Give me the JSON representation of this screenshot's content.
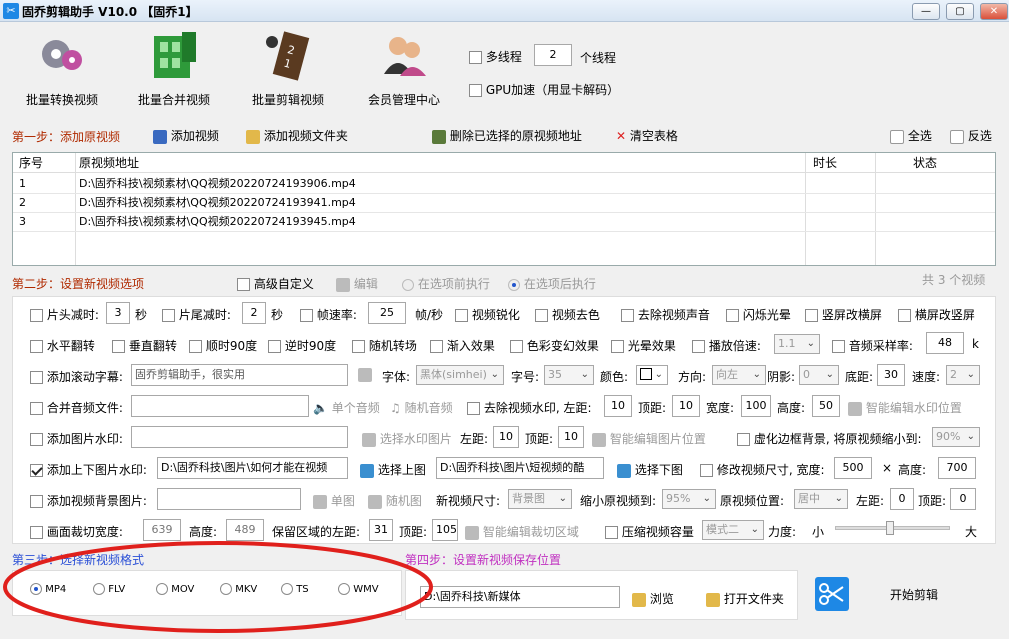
{
  "window": {
    "title": "固乔剪辑助手 V10.0  【固乔1】",
    "icon": "scissors-app-icon",
    "controls": [
      "—",
      "▢",
      "✕"
    ]
  },
  "toolbar": {
    "batch_convert": "批量转换视频",
    "batch_merge": "批量合并视频",
    "batch_edit": "批量剪辑视频",
    "member": "会员管理中心",
    "multithread_label": "多线程",
    "thread_count": "2",
    "thread_unit": "个线程",
    "gpu_label": "GPU加速（用显卡解码）"
  },
  "step1": {
    "title": "第一步：添加原视频",
    "add_video": "添加视频",
    "add_folder": "添加视频文件夹",
    "delete_selected": "删除已选择的原视频地址",
    "clear_table": "清空表格",
    "select_all": "全选",
    "invert_select": "反选"
  },
  "table": {
    "headers": [
      "序号",
      "原视频地址",
      "时长",
      "状态"
    ],
    "rows": [
      {
        "idx": "1",
        "path": "D:\\固乔科技\\视频素材\\QQ视频20220724193906.mp4",
        "duration": "",
        "status": ""
      },
      {
        "idx": "2",
        "path": "D:\\固乔科技\\视频素材\\QQ视频20220724193941.mp4",
        "duration": "",
        "status": ""
      },
      {
        "idx": "3",
        "path": "D:\\固乔科技\\视频素材\\QQ视频20220724193945.mp4",
        "duration": "",
        "status": ""
      }
    ]
  },
  "step2": {
    "title": "第二步：设置新视频选项",
    "advanced": "高级自定义",
    "edit": "编辑",
    "before": "在选项前执行",
    "after": "在选项后执行",
    "total": "共 3 个视频"
  },
  "opts": {
    "head_cut": "片头减时:",
    "head_val": "3",
    "sec": "秒",
    "tail_cut": "片尾减时:",
    "tail_val": "2",
    "fps": "帧速率:",
    "fps_val": "25",
    "fps_unit": "帧/秒",
    "sharpen": "视频锐化",
    "decolor": "视频去色",
    "remove_audio": "去除视频声音",
    "flash": "闪烁光晕",
    "v2h": "竖屏改横屏",
    "h2v": "横屏改竖屏",
    "hflip": "水平翻转",
    "vflip": "垂直翻转",
    "rot90": "顺时90度",
    "rrot90": "逆时90度",
    "random_trans": "随机转场",
    "fade_in": "渐入效果",
    "color_fx": "色彩变幻效果",
    "halo": "光晕效果",
    "speed": "播放倍速:",
    "speed_val": "1.1",
    "sample_rate": "音频采样率:",
    "sample_val": "48",
    "sample_unit": "k",
    "scroll_sub": "添加滚动字幕:",
    "scroll_text": "固乔剪辑助手，很实用",
    "font": "字体:",
    "font_val": "黑体(simhei)",
    "size": "字号:",
    "size_val": "35",
    "color": "颜色:",
    "dir": "方向:",
    "dir_val": "向左",
    "shadow": "阴影:",
    "shadow_val": "0",
    "bottom": "底距:",
    "bottom_val": "30",
    "speed2": "速度:",
    "speed2_val": "2",
    "merge_audio": "合并音频文件:",
    "single_audio": "单个音频",
    "random_audio": "随机音频",
    "remove_wm": "去除视频水印, 左距:",
    "wm_left": "10",
    "top": "顶距:",
    "wm_top": "10",
    "width": "宽度:",
    "wm_w": "100",
    "height": "高度:",
    "wm_h": "50",
    "smart_wm": "智能编辑水印位置",
    "img_wm": "添加图片水印:",
    "sel_wm_img": "选择水印图片",
    "left": "左距:",
    "img_left": "10",
    "img_top": "10",
    "smart_img": "智能编辑图片位置",
    "blur_bg": "虚化边框背景, 将原视频缩小到:",
    "blur_val": "90%",
    "tb_img": "添加上下图片水印:",
    "top_img_path": "D:\\固乔科技\\图片\\如何才能在视频",
    "sel_top": "选择上图",
    "bottom_img_path": "D:\\固乔科技\\图片\\短视频的酷",
    "sel_bottom": "选择下图",
    "resize": "修改视频尺寸, 宽度:",
    "resize_w": "500",
    "times": "×",
    "height2": "高度:",
    "resize_h": "700",
    "bg_img": "添加视频背景图片:",
    "single_img": "单图",
    "random_img": "随机图",
    "new_size": "新视频尺寸:",
    "new_size_val": "背景图",
    "shrink": "缩小原视频到:",
    "shrink_val": "95%",
    "pos": "原视频位置:",
    "pos_val": "居中",
    "pos_left": "左距:",
    "pos_left_val": "0",
    "pos_top": "顶距:",
    "pos_top_val": "0",
    "crop": "画面裁切宽度:",
    "crop_w": "639",
    "crop_h_label": "高度:",
    "crop_h": "489",
    "keep": "保留区域的左距:",
    "keep_left": "31",
    "keep_top_label": "顶距:",
    "keep_top": "105",
    "smart_crop": "智能编辑裁切区域",
    "compress": "压缩视频容量",
    "mode_val": "模式二",
    "strength": "力度:",
    "small": "小",
    "big": "大"
  },
  "step3": {
    "title": "第三步：选择新视频格式",
    "formats": [
      "MP4",
      "FLV",
      "MOV",
      "MKV",
      "TS",
      "WMV"
    ],
    "selected": "MP4"
  },
  "step4": {
    "title": "第四步：设置新视频保存位置",
    "path": "D:\\固乔科技\\新媒体",
    "browse": "浏览",
    "open_folder": "打开文件夹",
    "start": "开始剪辑"
  },
  "colors": {
    "annotation_circle": "#e0201c",
    "step1": "#b02a00",
    "step3": "#2a4fd6",
    "step4": "#c030c0"
  }
}
